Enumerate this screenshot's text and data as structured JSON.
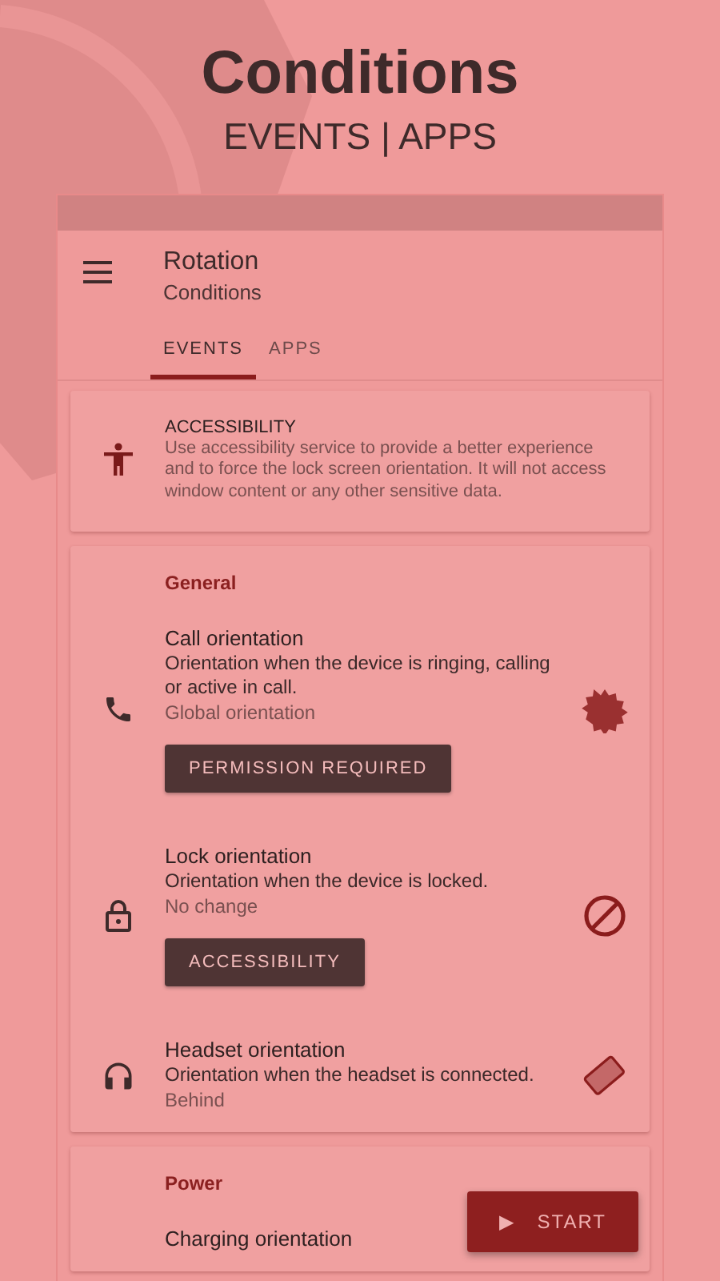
{
  "header": {
    "title": "Conditions",
    "subtitle": "EVENTS | APPS"
  },
  "app_bar": {
    "title": "Rotation",
    "subtitle": "Conditions"
  },
  "tabs": [
    {
      "label": "EVENTS",
      "selected": true
    },
    {
      "label": "APPS",
      "selected": false
    }
  ],
  "notice": {
    "title": "ACCESSIBILITY",
    "text": "Use accessibility service to provide a better experience and to force the lock screen orientation. It will not access window content or any other sensitive data."
  },
  "sections": [
    {
      "title": "General",
      "items": [
        {
          "title": "Call orientation",
          "description": "Orientation when the device is ringing, calling or active in call.",
          "value": "Global orientation",
          "button": "PERMISSION REQUIRED"
        },
        {
          "title": "Lock orientation",
          "description": "Orientation when the device is locked.",
          "value": "No change",
          "button": "ACCESSIBILITY"
        },
        {
          "title": "Headset orientation",
          "description": "Orientation when the headset is connected.",
          "value": "Behind"
        }
      ]
    },
    {
      "title": "Power",
      "items": [
        {
          "title": "Charging orientation"
        }
      ]
    }
  ],
  "fab": {
    "icon": "▶",
    "label": "START"
  }
}
